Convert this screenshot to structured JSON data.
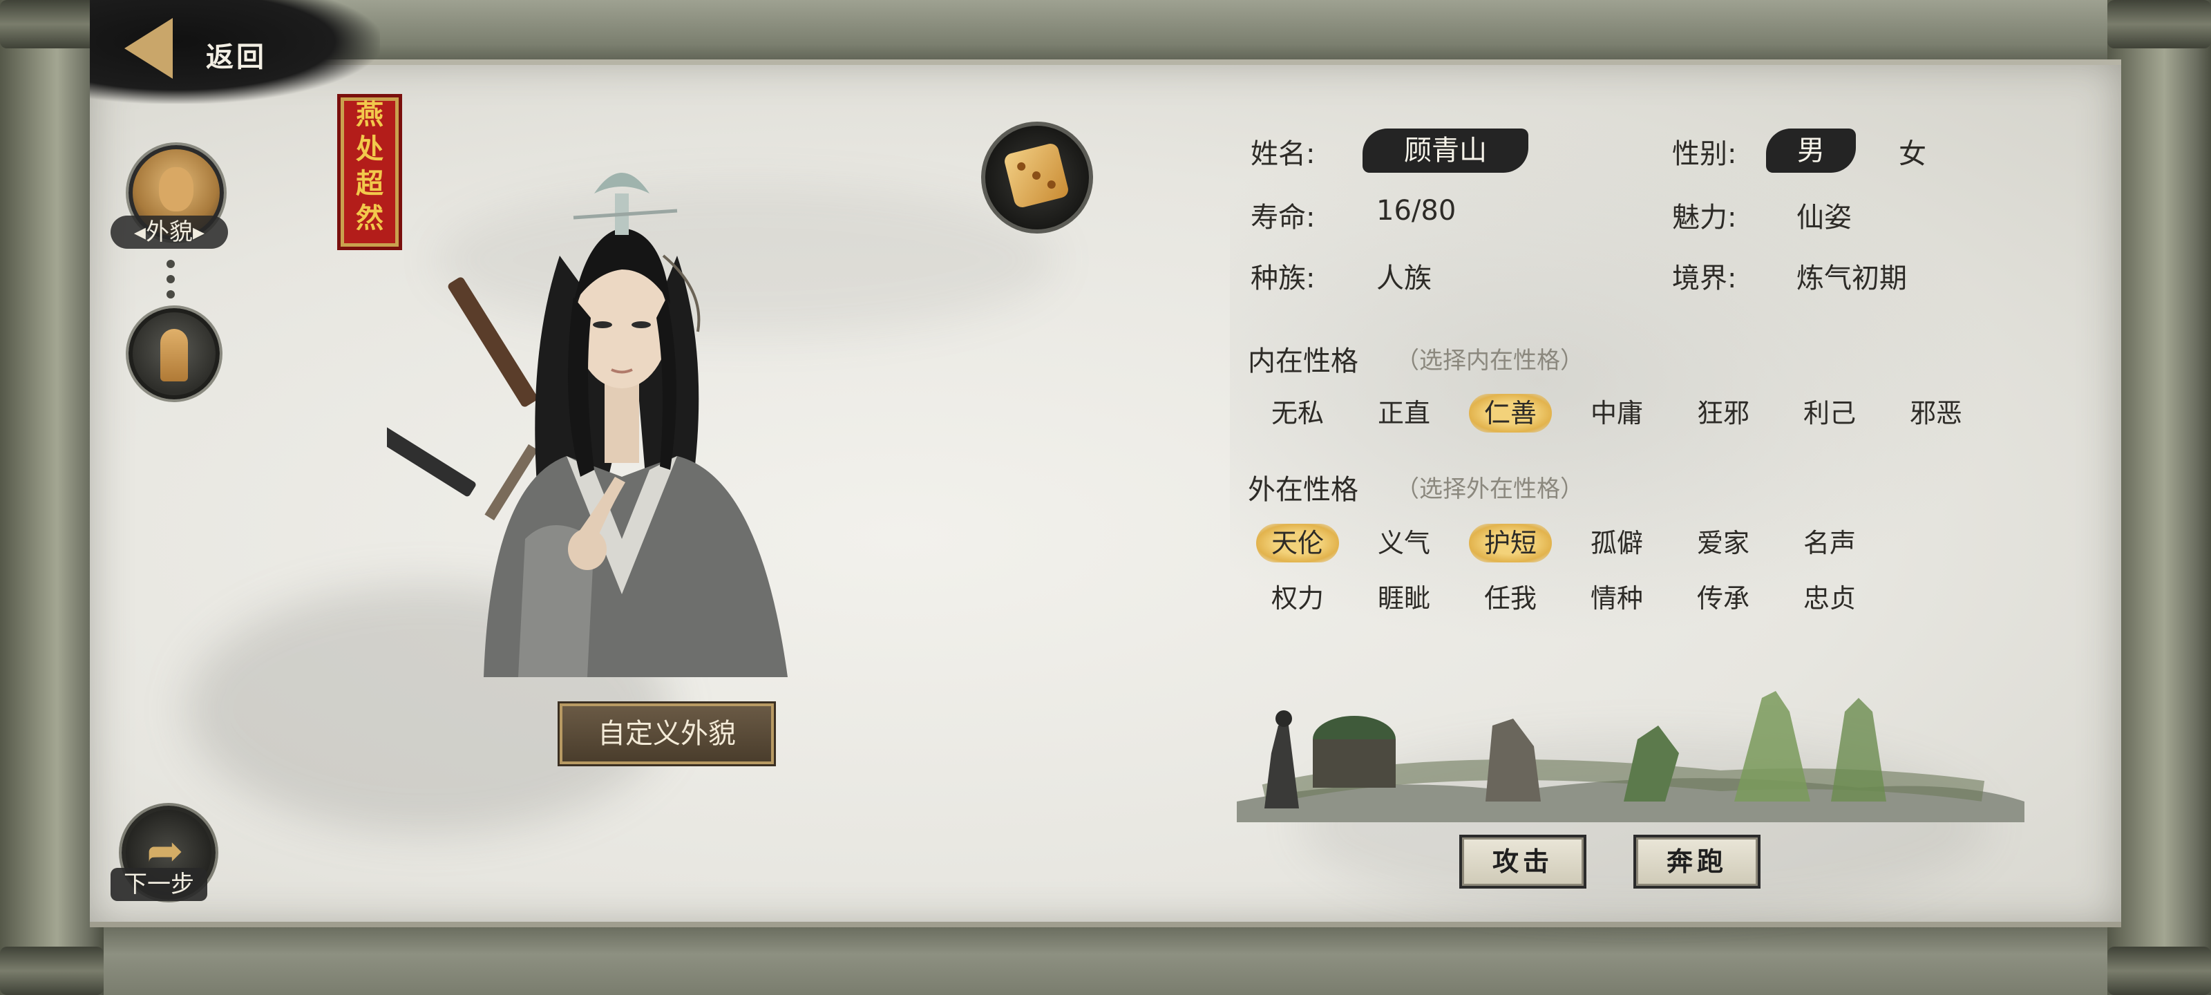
{
  "nav": {
    "back_label": "返回"
  },
  "side": {
    "appearance_label": "外貌",
    "next_label": "下一步"
  },
  "seal": {
    "chars": [
      "燕",
      "处",
      "超",
      "然"
    ]
  },
  "character": {
    "customize_label": "自定义外貌"
  },
  "info": {
    "name_label": "姓名:",
    "name_value": "顾青山",
    "gender_label": "性别:",
    "gender_male": "男",
    "gender_female": "女",
    "lifespan_label": "寿命:",
    "lifespan_value": "16/80",
    "charm_label": "魅力:",
    "charm_value": "仙姿",
    "race_label": "种族:",
    "race_value": "人族",
    "realm_label": "境界:",
    "realm_value": "炼气初期"
  },
  "inner": {
    "title": "内在性格",
    "hint": "（选择内在性格）",
    "traits": [
      "无私",
      "正直",
      "仁善",
      "中庸",
      "狂邪",
      "利己",
      "邪恶"
    ],
    "selected": "仁善"
  },
  "outer": {
    "title": "外在性格",
    "hint": "（选择外在性格）",
    "row1": [
      "天伦",
      "义气",
      "护短",
      "孤僻",
      "爱家",
      "名声"
    ],
    "row2": [
      "权力",
      "睚眦",
      "任我",
      "情种",
      "传承",
      "忠贞"
    ],
    "selected": [
      "天伦",
      "护短"
    ]
  },
  "actions": {
    "attack": "攻击",
    "run": "奔跑"
  },
  "colors": {
    "accent_gold": "#e2b34d",
    "seal_red": "#b31d1a",
    "ink": "#242424"
  }
}
